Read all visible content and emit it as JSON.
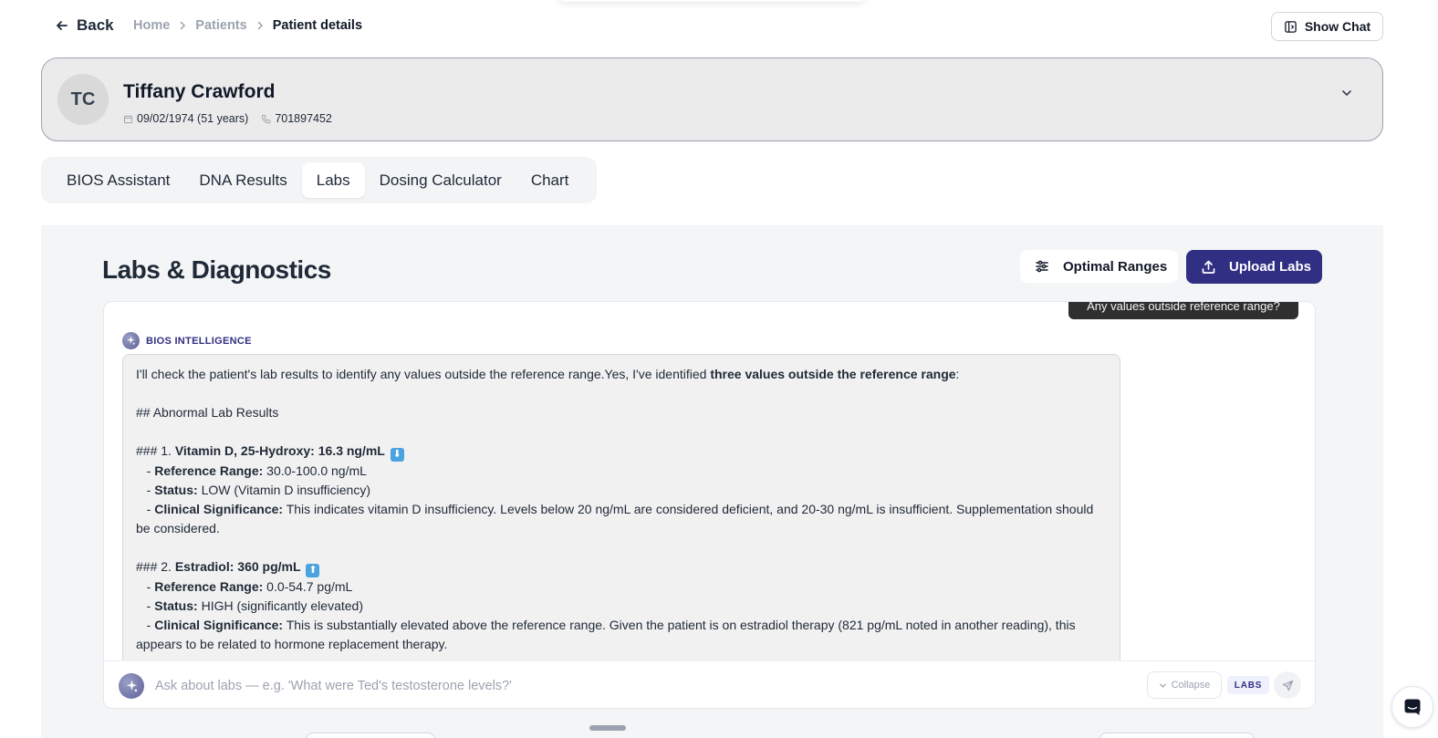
{
  "nav": {
    "back_label": "Back",
    "breadcrumbs": [
      "Home",
      "Patients",
      "Patient details"
    ],
    "show_chat_label": "Show Chat"
  },
  "patient": {
    "initials": "TC",
    "name": "Tiffany Crawford",
    "dob": "09/02/1974 (51 years)",
    "phone": "701897452"
  },
  "tabs": [
    {
      "label": "BIOS Assistant",
      "active": false
    },
    {
      "label": "DNA Results",
      "active": false
    },
    {
      "label": "Labs",
      "active": true
    },
    {
      "label": "Dosing Calculator",
      "active": false
    },
    {
      "label": "Chart",
      "active": false
    }
  ],
  "labs": {
    "title": "Labs & Diagnostics",
    "optimal_ranges_label": "Optimal Ranges",
    "upload_label": "Upload Labs"
  },
  "chat": {
    "user_message": "Any values outside reference range?",
    "ai_label": "BIOS INTELLIGENCE",
    "response": {
      "intro": "I'll check the patient's lab results to identify any values outside the reference range.Yes, I've identified ",
      "intro_bold": "three values outside the reference range",
      "intro_end": ":",
      "heading": "## Abnormal Lab Results",
      "items": [
        {
          "prefix": "### 1. ",
          "title": "Vitamin D, 25-Hydroxy: 16.3 ng/mL",
          "arrow": "⬇",
          "range_label": "Reference Range:",
          "range": " 30.0-100.0 ng/mL",
          "status_label": "Status:",
          "status": " LOW (Vitamin D insufficiency)",
          "sig_label": "Clinical Significance:",
          "sig": " This indicates vitamin D insufficiency. Levels below 20 ng/mL are considered deficient, and 20-30 ng/mL is insufficient. Supplementation should be considered."
        },
        {
          "prefix": "### 2. ",
          "title": "Estradiol: 360 pg/mL",
          "arrow": "⬆",
          "range_label": "Reference Range:",
          "range": " 0.0-54.7 pg/mL",
          "status_label": "Status:",
          "status": " HIGH (significantly elevated)",
          "sig_label": "Clinical Significance:",
          "sig": " This is substantially elevated above the reference range. Given the patient is on estradiol therapy (821 pg/mL noted in another reading), this appears to be related to hormone replacement therapy."
        }
      ]
    },
    "input_placeholder": "Ask about labs — e.g. 'What were Ted's testosterone levels?'",
    "collapse_label": "Collapse",
    "badge_label": "LABS"
  },
  "colors": {
    "primary": "#302f83",
    "card_bg": "#ebebeb",
    "panel_bg": "#f4f5f6"
  }
}
